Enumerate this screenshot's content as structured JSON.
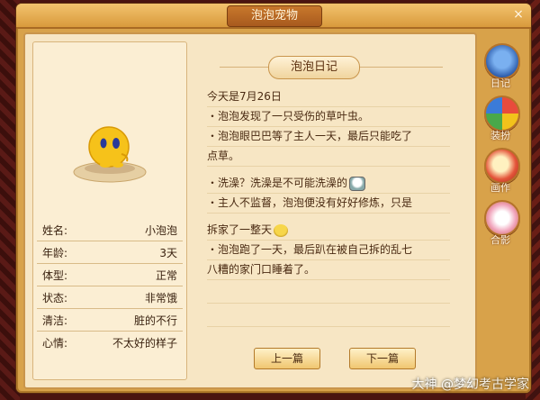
{
  "window": {
    "title": "泡泡宠物",
    "close_symbol": "×"
  },
  "pet": {
    "stats": [
      {
        "label": "姓名:",
        "value": "小泡泡"
      },
      {
        "label": "年龄:",
        "value": "3天"
      },
      {
        "label": "体型:",
        "value": "正常"
      },
      {
        "label": "状态:",
        "value": "非常饿"
      },
      {
        "label": "清洁:",
        "value": "脏的不行"
      },
      {
        "label": "心情:",
        "value": "不太好的样子"
      }
    ]
  },
  "diary": {
    "title": "泡泡日记",
    "lines": [
      "今天是7月26日",
      "・泡泡发现了一只受伤的草叶虫。",
      "・泡泡眼巴巴等了主人一天，最后只能吃了",
      "点草。",
      "・洗澡？洗澡是不可能洗澡的",
      "・主人不监督，泡泡便没有好好修炼，只是",
      "拆家了一整天",
      "・泡泡跑了一天，最后趴在被自己拆的乱七",
      "八糟的家门口睡着了。"
    ],
    "prev_label": "上一篇",
    "next_label": "下一篇"
  },
  "side_tabs": [
    {
      "label": "日记",
      "icon": "diary-icon"
    },
    {
      "label": "装扮",
      "icon": "pinwheel-icon"
    },
    {
      "label": "画作",
      "icon": "painting-icon"
    },
    {
      "label": "合影",
      "icon": "photo-icon"
    }
  ],
  "watermark": "大神 @梦幻考古学家",
  "colors": {
    "frame": "#d8a24a",
    "parchment": "#f7e6c4",
    "accent": "#c9954c"
  }
}
